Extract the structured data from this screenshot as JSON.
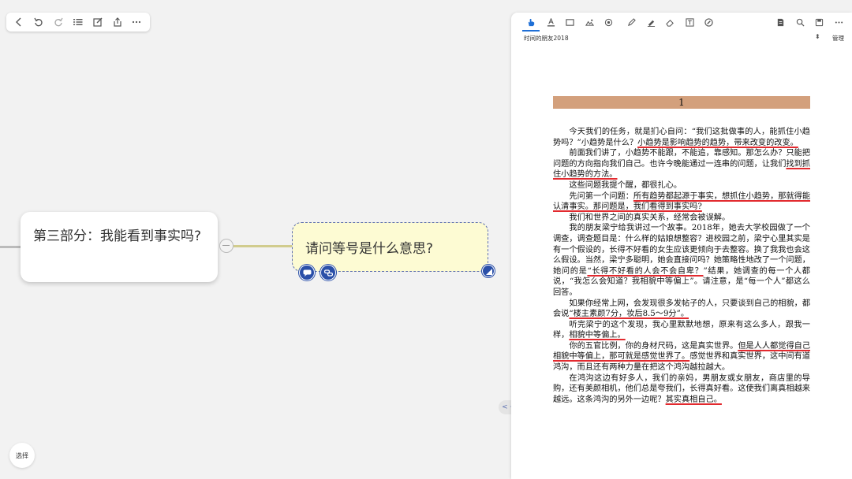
{
  "left_toolbar": {
    "buttons": [
      {
        "name": "back-button",
        "icon": "chevron-left-icon"
      },
      {
        "name": "undo-button",
        "icon": "undo-icon"
      },
      {
        "name": "redo-button",
        "icon": "redo-icon"
      },
      {
        "name": "outline-button",
        "icon": "list-icon"
      },
      {
        "name": "edit-button",
        "icon": "edit-icon"
      },
      {
        "name": "share-button",
        "icon": "share-icon"
      },
      {
        "name": "more-button",
        "icon": "more-icon"
      }
    ]
  },
  "mindmap": {
    "main_topic": "第三部分：我能看到事实吗?",
    "sub_topic": "请问等号是什么意思?",
    "connector_color": "#d1cc8e",
    "sub_border_color": "#5d6fb0",
    "sub_fill_color": "#fdfbd3"
  },
  "select_button": {
    "label": "选择"
  },
  "split_handle": {
    "label": "< · >"
  },
  "right_panel": {
    "toolbar": [
      {
        "name": "hand-tool-button",
        "icon": "hand-icon",
        "active": true
      },
      {
        "name": "text-highlight-button",
        "icon": "highlight-icon"
      },
      {
        "name": "rectangle-select-button",
        "icon": "rectangle-icon"
      },
      {
        "name": "image-button",
        "icon": "image-icon"
      },
      {
        "name": "link-button",
        "icon": "link-icon"
      },
      {
        "name": "pen-button",
        "icon": "pen-icon"
      },
      {
        "name": "marker-button",
        "icon": "marker-icon"
      },
      {
        "name": "eraser-button",
        "icon": "eraser-icon"
      },
      {
        "name": "textbox-button",
        "icon": "textbox-icon"
      },
      {
        "name": "compass-button",
        "icon": "compass-icon"
      },
      {
        "name": "document-button",
        "icon": "document-icon"
      },
      {
        "name": "search-button",
        "icon": "search-icon"
      },
      {
        "name": "save-button",
        "icon": "save-icon"
      },
      {
        "name": "more-button",
        "icon": "more-icon"
      }
    ],
    "active_color": "#1f6fd6",
    "doc_title": "时间的朋友2018",
    "manage_label": "管理",
    "sort_glyph": "⬍",
    "chapter_number": "1",
    "chapter_color": "#d3a07c",
    "highlight_color": "#e22a2f",
    "paragraphs": [
      [
        {
          "t": "今天我们的任务，就是扪心自问：“我们这批做事的人，能抓住小趋势吗？”小趋势是什么？"
        },
        {
          "t": "小趋势是影响趋势的趋势，带来改变的改变。",
          "hl": true
        }
      ],
      [
        {
          "t": "前面我们讲了，小趋势不能跟，不能追，靠感知。那怎么办？只能把问题的方向指向我们自己。也许今晚能通过一连串的问题，让我们"
        },
        {
          "t": "找到抓住小趋势的方法。",
          "hl": true
        }
      ],
      [
        {
          "t": "这些问题我提个醒，都很扎心。"
        }
      ],
      [
        {
          "t": "先问第一个问题："
        },
        {
          "t": "所有趋势都起源于事实，想抓住小趋势，那就得能认清事实。那问题是，我们看得到事实吗?",
          "hl": true
        }
      ],
      [
        {
          "t": "我们和世界之间的真实关系，经常会被误解。"
        }
      ],
      [
        {
          "t": "我的朋友梁宁给我讲过一个故事。2018年，她去大学校园做了一个调查，调查题目是：什么样的姑娘想整容？进校园之前，梁宁心里其实是有一个假设的，长得不好看的女生应该更倾向于去整容。换了我我也会这么假设。当然，梁宁多聪明，她会直接问吗？她策略性地改了一个问题，她问的是"
        },
        {
          "t": "“长得不好看的人会不会自卑？",
          "hl": true
        },
        {
          "t": "”结果，她调查的每一个人都说，“我怎么会知道？我相貌中等偏上”。请注意，是“每一个人”都这么回答。"
        }
      ],
      [
        {
          "t": "如果你经常上网，会发现很多发帖子的人，只要谈到自己的相貌，都会说"
        },
        {
          "t": "“楼主素颜7分，妆后8.5～9分”。",
          "hl": true
        }
      ],
      [
        {
          "t": "听完梁宁的这个发现，我心里默默地想，原来有这么多人，跟我一样，"
        },
        {
          "t": "相貌中等偏上。",
          "hl": true
        }
      ],
      [
        {
          "t": "你的五官比例，你的身材尺码，这是真实世界。"
        },
        {
          "t": "但是人人都觉得自己相貌中等偏上，那可就是感觉世界了。",
          "hl": true
        },
        {
          "t": "感觉世界和真实世界，这中间有道鸿沟，而且还有两种力量在把这个鸿沟越拉越大。"
        }
      ],
      [
        {
          "t": "在鸿沟这边有好多人，我们的亲妈，男朋友或女朋友，商店里的导购，还有美颜相机，他们总是夸我们，长得真好看。这使我们离真相越来越远。这条鸿沟的另外一边呢？"
        },
        {
          "t": "其实真相自己。",
          "hl": true
        }
      ]
    ]
  }
}
